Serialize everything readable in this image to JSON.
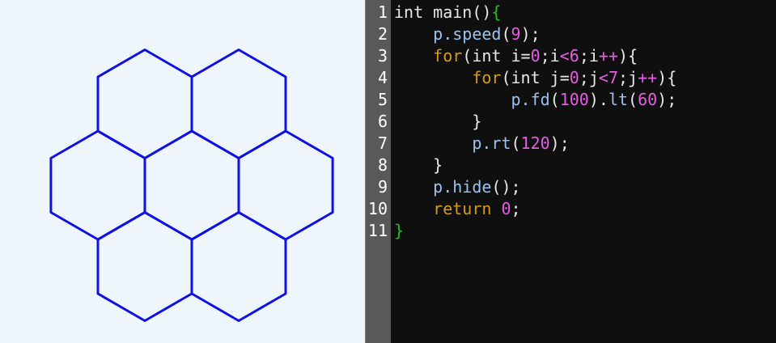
{
  "colors": {
    "canvas_bg": "#eef6fc",
    "hex_stroke": "#1010e0",
    "gutter_bg": "#595959",
    "editor_bg": "#0f0f0f",
    "keyword": "#d59b16",
    "number": "#e55ee0",
    "brace_green": "#22c022"
  },
  "canvas": {
    "shape": "hexagon-cluster",
    "hexagon_count": 7
  },
  "editor": {
    "line_numbers": [
      "1",
      "2",
      "3",
      "4",
      "5",
      "6",
      "7",
      "8",
      "9",
      "10",
      "11"
    ],
    "lines": [
      [
        {
          "t": "int main",
          "c": "plain"
        },
        {
          "t": "()",
          "c": "punct"
        },
        {
          "t": "{",
          "c": "green"
        }
      ],
      [
        {
          "t": "    ",
          "c": "plain"
        },
        {
          "t": "p.speed",
          "c": "member"
        },
        {
          "t": "(",
          "c": "punct"
        },
        {
          "t": "9",
          "c": "num"
        },
        {
          "t": ");",
          "c": "punct"
        }
      ],
      [
        {
          "t": "    ",
          "c": "plain"
        },
        {
          "t": "for",
          "c": "kw"
        },
        {
          "t": "(int i=",
          "c": "plain"
        },
        {
          "t": "0",
          "c": "num"
        },
        {
          "t": ";i",
          "c": "plain"
        },
        {
          "t": "<",
          "c": "op"
        },
        {
          "t": "6",
          "c": "num"
        },
        {
          "t": ";i",
          "c": "plain"
        },
        {
          "t": "++",
          "c": "op"
        },
        {
          "t": "){",
          "c": "punct"
        }
      ],
      [
        {
          "t": "        ",
          "c": "plain"
        },
        {
          "t": "for",
          "c": "kw"
        },
        {
          "t": "(int j=",
          "c": "plain"
        },
        {
          "t": "0",
          "c": "num"
        },
        {
          "t": ";j",
          "c": "plain"
        },
        {
          "t": "<",
          "c": "op"
        },
        {
          "t": "7",
          "c": "num"
        },
        {
          "t": ";j",
          "c": "plain"
        },
        {
          "t": "++",
          "c": "op"
        },
        {
          "t": "){",
          "c": "punct"
        }
      ],
      [
        {
          "t": "            ",
          "c": "plain"
        },
        {
          "t": "p.fd",
          "c": "member"
        },
        {
          "t": "(",
          "c": "punct"
        },
        {
          "t": "100",
          "c": "num"
        },
        {
          "t": ").",
          "c": "punct"
        },
        {
          "t": "lt",
          "c": "member"
        },
        {
          "t": "(",
          "c": "punct"
        },
        {
          "t": "60",
          "c": "num"
        },
        {
          "t": ");",
          "c": "punct"
        }
      ],
      [
        {
          "t": "        }",
          "c": "punct"
        }
      ],
      [
        {
          "t": "        ",
          "c": "plain"
        },
        {
          "t": "p.rt",
          "c": "member"
        },
        {
          "t": "(",
          "c": "punct"
        },
        {
          "t": "120",
          "c": "num"
        },
        {
          "t": ");",
          "c": "punct"
        }
      ],
      [
        {
          "t": "    }",
          "c": "punct"
        }
      ],
      [
        {
          "t": "    ",
          "c": "plain"
        },
        {
          "t": "p.hide",
          "c": "member"
        },
        {
          "t": "();",
          "c": "punct"
        }
      ],
      [
        {
          "t": "    ",
          "c": "plain"
        },
        {
          "t": "return",
          "c": "kw"
        },
        {
          "t": " ",
          "c": "plain"
        },
        {
          "t": "0",
          "c": "num"
        },
        {
          "t": ";",
          "c": "punct"
        }
      ],
      [
        {
          "t": "}",
          "c": "green"
        }
      ]
    ]
  }
}
